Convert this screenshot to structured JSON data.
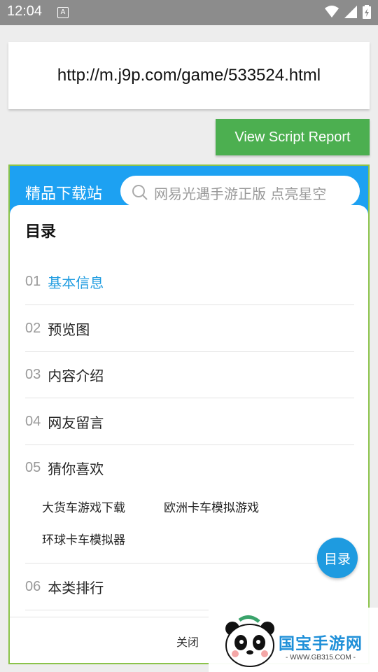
{
  "status_bar": {
    "time": "12:04",
    "notification_letter": "A",
    "icons": [
      "wifi-icon",
      "signal-icon",
      "battery-icon"
    ]
  },
  "url_bar": {
    "url": "http://m.j9p.com/game/533524.html"
  },
  "report_button": {
    "label": "View Script Report",
    "color": "#4caf50"
  },
  "site": {
    "logo": "精品下载站",
    "search_placeholder": "网易光遇手游正版 点亮星空",
    "header_color": "#1da1f2"
  },
  "directory": {
    "title": "目录",
    "items": [
      {
        "num": "01",
        "label": "基本信息",
        "active": true
      },
      {
        "num": "02",
        "label": "预览图"
      },
      {
        "num": "03",
        "label": "内容介绍"
      },
      {
        "num": "04",
        "label": "网友留言"
      },
      {
        "num": "05",
        "label": "猜你喜欢"
      },
      {
        "num": "06",
        "label": "本类排行"
      }
    ],
    "related_links": [
      "大货车游戏下载",
      "欧洲卡车模拟游戏",
      "环球卡车模拟器"
    ],
    "close_label": "关闭",
    "active_color": "#1e9be0"
  },
  "fab": {
    "label": "目录"
  },
  "watermark": {
    "brand": "国宝手游网",
    "url": "- WWW.GB315.COM -"
  }
}
